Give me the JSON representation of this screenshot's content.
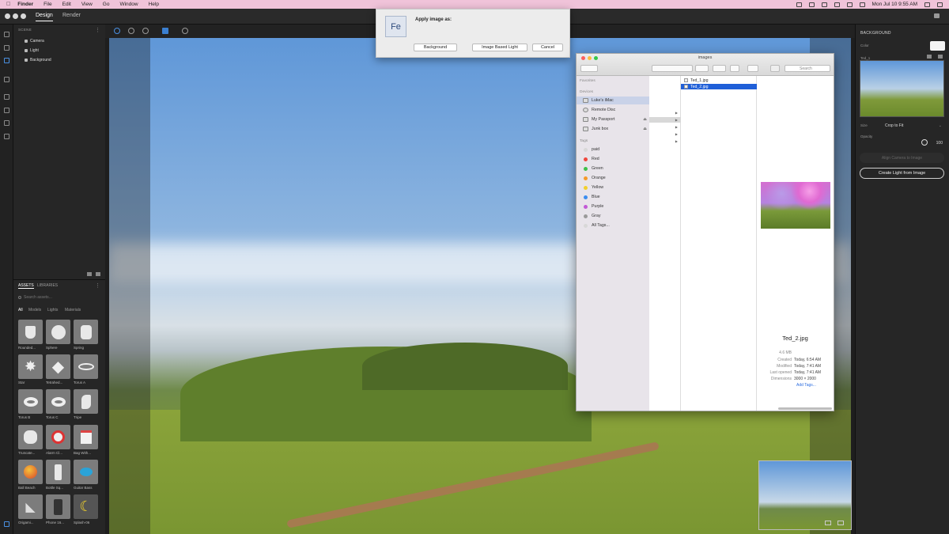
{
  "menubar": {
    "app": "Finder",
    "items": [
      "File",
      "Edit",
      "View",
      "Go",
      "Window",
      "Help"
    ],
    "clock": "Mon Jul 10  9:55 AM"
  },
  "appbar": {
    "tabs": [
      "Design",
      "Render"
    ]
  },
  "scene": {
    "header": "SCENE",
    "items": [
      "Camera",
      "Light",
      "Background"
    ]
  },
  "assets": {
    "tabs": [
      "ASSETS",
      "LIBRARIES"
    ],
    "search_placeholder": "Search assets...",
    "categories": [
      "All",
      "Models",
      "Lights",
      "Materials"
    ],
    "items": [
      "Rounded...",
      "Sphere",
      "Spring",
      "Star",
      "Tetrahed...",
      "Torus A",
      "Torus B",
      "Torus C",
      "Tripe",
      "Truncate...",
      "Alarm Cl...",
      "Bag With...",
      "Ball Beach",
      "Bottle Sq...",
      "Guitar Bass",
      "Origami...",
      "Phone 16...",
      "Splash-06"
    ]
  },
  "right_panel": {
    "header": "BACKGROUND",
    "color_label": "Color",
    "image_name": "Ted_1",
    "size_label": "Size",
    "size_value": "Crop to Fit",
    "opacity_label": "Opacity",
    "opacity_value": "100",
    "align_button": "Align Camera to Image",
    "create_button": "Create Light from Image"
  },
  "dialog": {
    "logo": "Fe",
    "title": "Apply image as:",
    "buttons": [
      "Background",
      "Image Based Light",
      "Cancel"
    ]
  },
  "finder": {
    "title": "images",
    "search_placeholder": "Search",
    "favorites_label": "Favorites",
    "devices_label": "Devices",
    "devices": [
      "Luke's iMac",
      "Remote Disc",
      "My Passport",
      "Junk box"
    ],
    "tags_label": "Tags",
    "tags": [
      {
        "name": "paid",
        "color": "#d8d8d8"
      },
      {
        "name": "Red",
        "color": "#f0463d"
      },
      {
        "name": "Green",
        "color": "#3ec04a"
      },
      {
        "name": "Orange",
        "color": "#f59a2a"
      },
      {
        "name": "Yellow",
        "color": "#f2cf2d"
      },
      {
        "name": "Blue",
        "color": "#3a8df0"
      },
      {
        "name": "Purple",
        "color": "#c25ad6"
      },
      {
        "name": "Gray",
        "color": "#9a9a9a"
      },
      {
        "name": "All Tags...",
        "color": "#d8d8d8"
      }
    ],
    "files": [
      "Ted_1.jpg",
      "Ted_2.jpg"
    ],
    "preview": {
      "name": "Ted_2.jpg",
      "size": "4.6 MB",
      "created_label": "Created",
      "created": "Today, 6:54 AM",
      "modified_label": "Modified",
      "modified": "Today, 7:41 AM",
      "opened_label": "Last opened",
      "opened": "Today, 7:41 AM",
      "dimensions_label": "Dimensions",
      "dimensions": "3000 × 2000",
      "add_tags": "Add Tags..."
    }
  }
}
